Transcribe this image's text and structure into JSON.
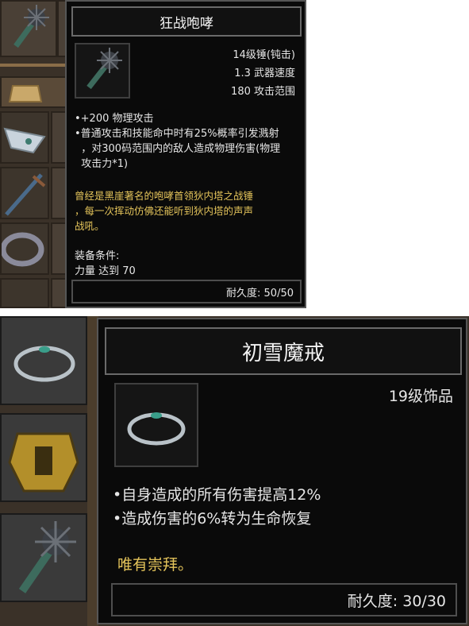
{
  "mace_tooltip": {
    "title": "狂战咆哮",
    "stats": [
      "14级锤(钝击)",
      "1.3 武器速度",
      "180 攻击范围"
    ],
    "effects": [
      "•+200 物理攻击",
      "•普通攻击和技能命中时有25%概率引发溅射",
      "  ，对300码范围内的敌人造成物理伤害(物理",
      "  攻击力*1)"
    ],
    "lore": [
      "曾经是黑崖著名的咆哮首领狄内塔之战锤",
      "，每一次挥动仿佛还能听到狄内塔的声声",
      "战吼。"
    ],
    "requirement_label": "装备条件:",
    "requirement": "力量 达到 70",
    "durability": "耐久度: 50/50"
  },
  "ring_tooltip": {
    "title": "初雪魔戒",
    "stats": [
      "19级饰品"
    ],
    "effects": [
      "•自身造成的所有伤害提高12%",
      "•造成伤害的6%转为生命恢复"
    ],
    "lore": [
      "唯有崇拜。"
    ],
    "durability": "耐久度: 30/30"
  },
  "colors": {
    "panel_bg": "#0a0a0a",
    "text": "#e6e6e6",
    "lore": "#e3c35a",
    "inventory_bg": "#3a3128"
  }
}
